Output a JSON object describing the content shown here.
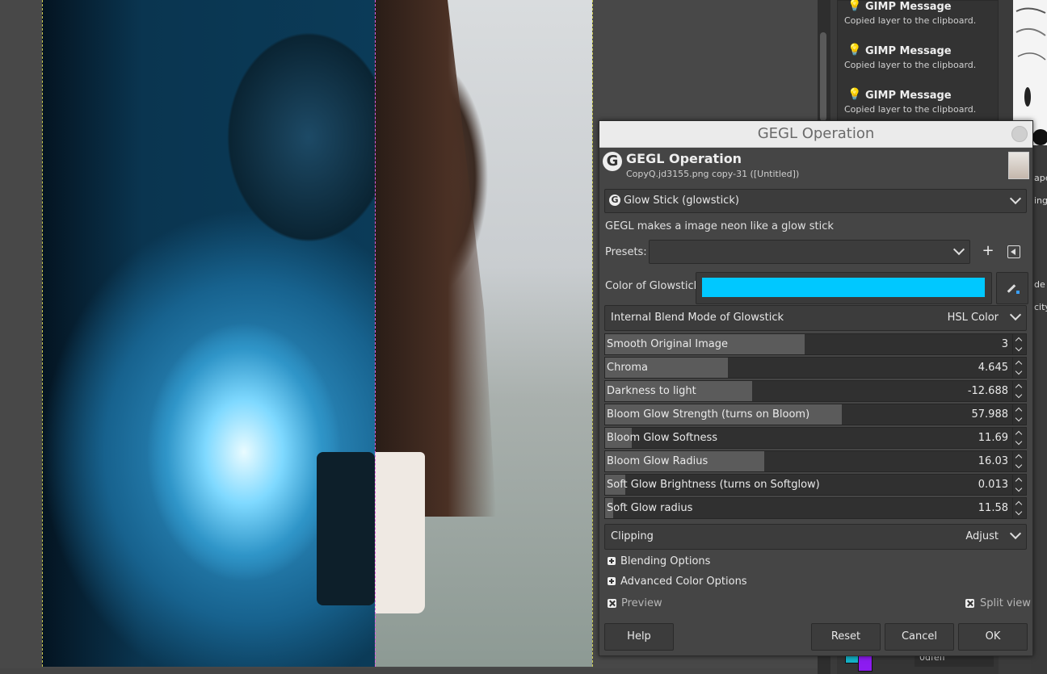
{
  "messages": [
    {
      "title": "GIMP Message",
      "body": "Copied layer to the clipboard."
    },
    {
      "title": "GIMP Message",
      "body": "Copied layer to the clipboard."
    },
    {
      "title": "GIMP Message",
      "body": "Copied layer to the clipboard."
    }
  ],
  "right_strip": {
    "item1": "ape",
    "item2": "ing",
    "item3": "de",
    "item4": "city"
  },
  "dock_bottom": {
    "field": "0dfeff"
  },
  "colors": {
    "foreground": "#8c1cf0",
    "background": "#14b3c9"
  },
  "dialog": {
    "window_title": "GEGL Operation",
    "header_title": "GEGL Operation",
    "header_subtitle": "CopyQ.jd3155.png copy-31 ([Untitled])",
    "operation": "Glow Stick (glowstick)",
    "description": "GEGL makes a image neon like a glow stick",
    "presets_label": "Presets:",
    "presets_value": "",
    "color_label": "Color of Glowstick",
    "color_value": "#00c8ff",
    "blend_label": "Internal Blend Mode of Glowstick",
    "blend_value": "HSL Color",
    "sliders": [
      {
        "label": "Smooth Original Image",
        "value": "3",
        "fill": 0.49
      },
      {
        "label": "Chroma",
        "value": "4.645",
        "fill": 0.3
      },
      {
        "label": "Darkness to light",
        "value": "-12.688",
        "fill": 0.36
      },
      {
        "label": "Bloom Glow Strength (turns on Bloom)",
        "value": "57.988",
        "fill": 0.58
      },
      {
        "label": "Bloom Glow Softness",
        "value": "11.69",
        "fill": 0.065
      },
      {
        "label": "Bloom Glow Radius",
        "value": "16.03",
        "fill": 0.39
      },
      {
        "label": "Soft Glow Brightness (turns on Softglow)",
        "value": "0.013",
        "fill": 0.05
      },
      {
        "label": "Soft Glow radius",
        "value": "11.58",
        "fill": 0.02
      }
    ],
    "clipping_label": "Clipping",
    "clipping_value": "Adjust",
    "blending_options": "Blending Options",
    "advanced_color": "Advanced Color Options",
    "preview_label": "Preview",
    "split_view_label": "Split view",
    "buttons": {
      "help": "Help",
      "reset": "Reset",
      "cancel": "Cancel",
      "ok": "OK"
    }
  }
}
